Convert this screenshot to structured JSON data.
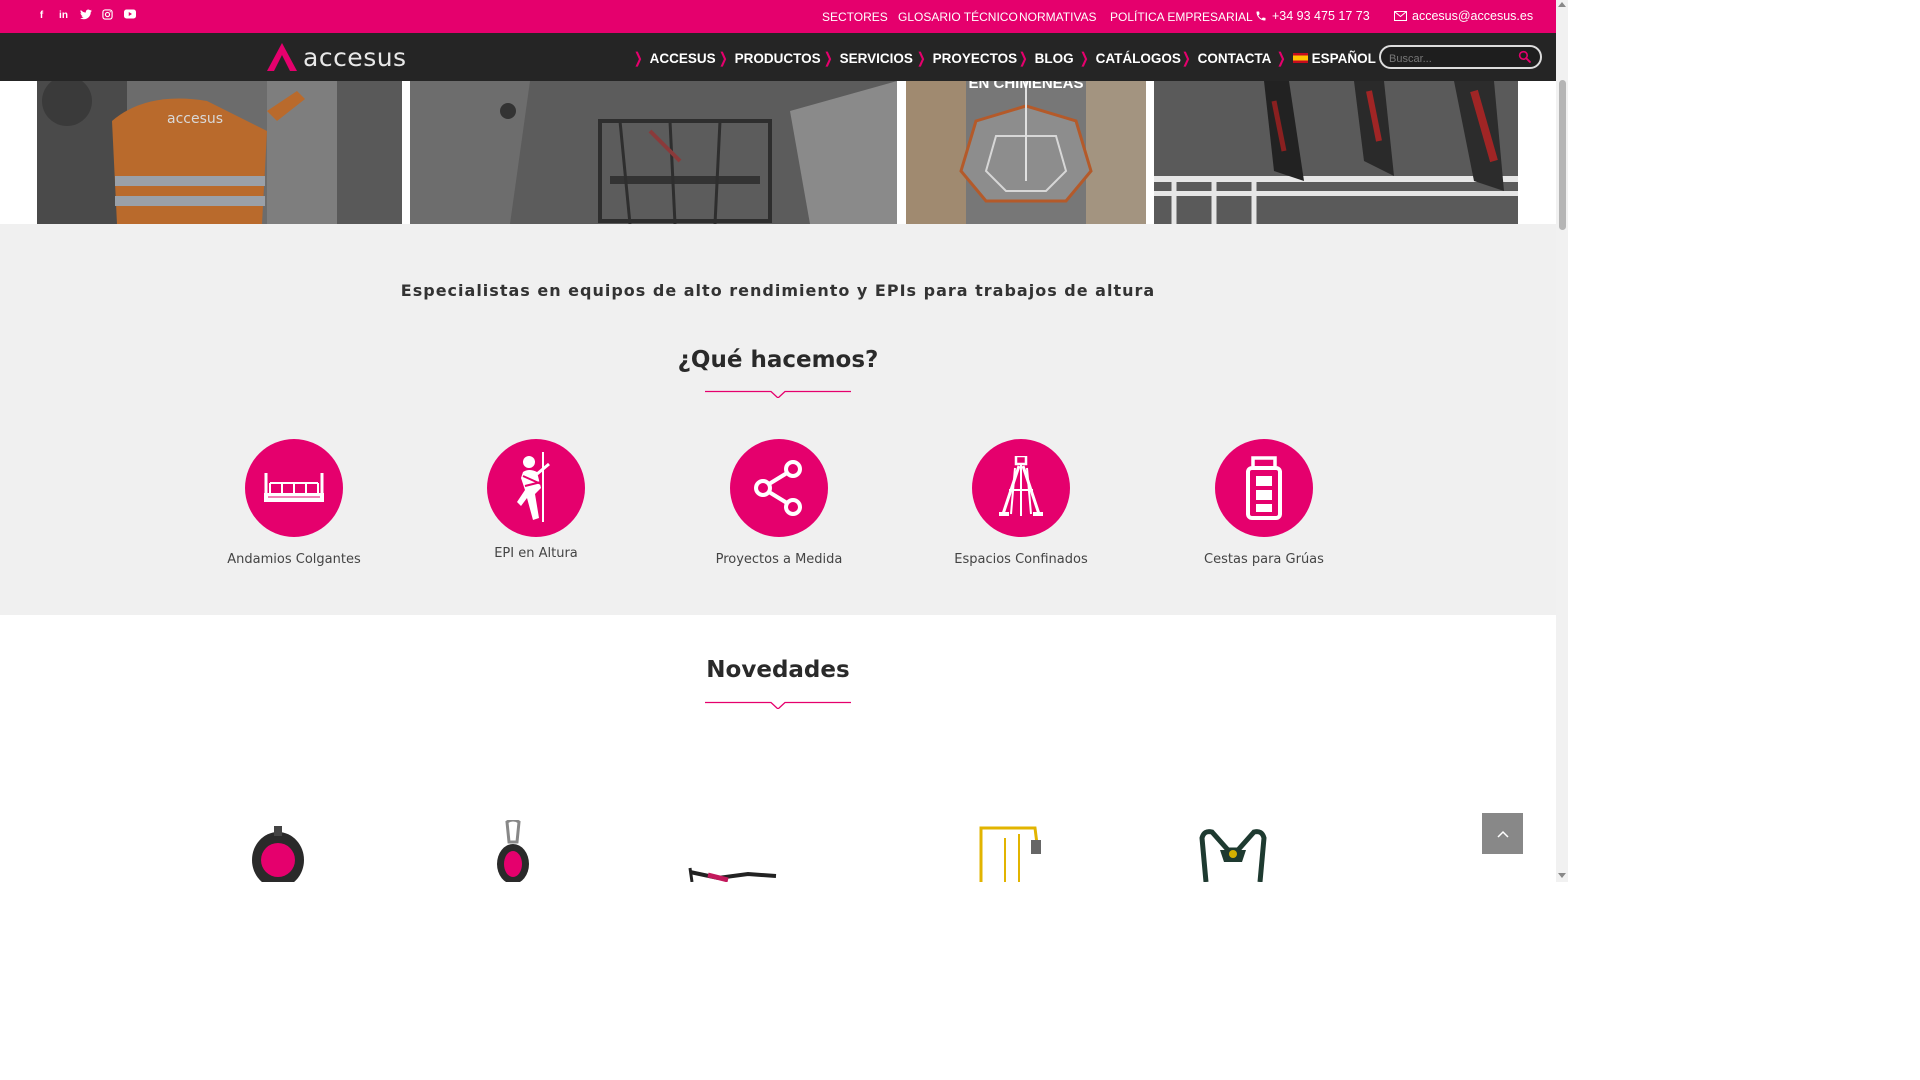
{
  "topbar": {
    "social_icons": [
      "facebook-icon",
      "linkedin-icon",
      "twitter-icon",
      "instagram-icon",
      "youtube-icon"
    ],
    "links": [
      {
        "label": "SECTORES"
      },
      {
        "label": "GLOSARIO TÉCNICO"
      },
      {
        "label": "NORMATIVAS"
      },
      {
        "label": "POLÍTICA EMPRESARIAL"
      }
    ],
    "phone": "+34 93 475 17 73",
    "email": "accesus@accesus.es"
  },
  "navbar": {
    "logo_text": "accesus",
    "items": [
      {
        "label": "ACCESUS"
      },
      {
        "label": "PRODUCTOS"
      },
      {
        "label": "SERVICIOS"
      },
      {
        "label": "PROYECTOS"
      },
      {
        "label": "BLOG"
      },
      {
        "label": "CATÁLOGOS"
      },
      {
        "label": "CONTACTA"
      },
      {
        "label": "ESPAÑOL"
      }
    ],
    "search_placeholder": "Buscar..."
  },
  "hero": {
    "caption_3": "EN CHIMENEAS",
    "logo_on_jacket": "accesus"
  },
  "main": {
    "tagline": "Especialistas en equipos de alto rendimiento y EPIs para trabajos de altura",
    "section_title": "¿Qué hacemos?",
    "services": [
      {
        "label": "Andamios Colgantes",
        "icon": "suspended-scaffold-icon"
      },
      {
        "label": "EPI en Altura",
        "icon": "harness-worker-icon"
      },
      {
        "label": "Proyectos a Medida",
        "icon": "share-icon"
      },
      {
        "label": "Espacios Confinados",
        "icon": "tripod-icon"
      },
      {
        "label": "Cestas para Grúas",
        "icon": "crane-basket-icon"
      }
    ]
  },
  "novedades": {
    "title": "Novedades"
  },
  "colors": {
    "accent": "#e5006d",
    "nav_bg": "#252525",
    "section_bg": "#f0f0f0"
  }
}
